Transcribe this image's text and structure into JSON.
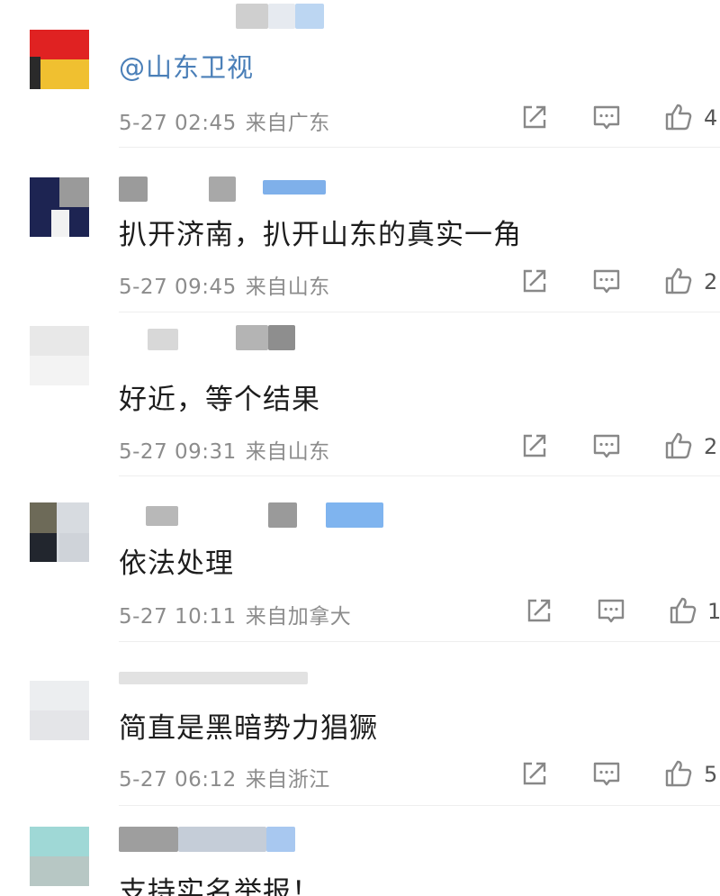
{
  "comments": [
    {
      "mention": "@山东卫视",
      "content": "",
      "date": "5-27 02:45",
      "location": "来自广东",
      "like_count": "4"
    },
    {
      "mention": "",
      "content": "扒开济南，扒开山东的真实一角",
      "date": "5-27 09:45",
      "location": "来自山东",
      "like_count": "2"
    },
    {
      "mention": "",
      "content": "好近，等个结果",
      "date": "5-27 09:31",
      "location": "来自山东",
      "like_count": "2"
    },
    {
      "mention": "",
      "content": "依法处理",
      "date": "5-27 10:11",
      "location": "来自加拿大",
      "like_count": "1"
    },
    {
      "mention": "",
      "content": "简直是黑暗势力猖獗",
      "date": "5-27 06:12",
      "location": "来自浙江",
      "like_count": "5"
    },
    {
      "mention": "",
      "content": "支持实名举报！",
      "date": "",
      "location": "",
      "like_count": ""
    }
  ],
  "icons": {
    "share": "share-icon",
    "comment": "comment-icon",
    "like": "like-icon"
  },
  "colors": {
    "mention": "#4a7fb8",
    "meta_text": "#8c8c8c",
    "icon": "#888888"
  }
}
